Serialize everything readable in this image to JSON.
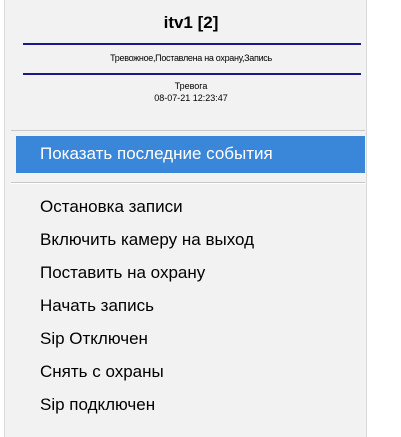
{
  "header": {
    "title": "itv1 [2]",
    "status": "Тревожное,Поставлена на охрану,Запись",
    "event_type": "Тревога",
    "event_time": "08-07-21 12:23:47"
  },
  "highlighted_item": {
    "label": "Показать последние события"
  },
  "menu_items": [
    {
      "label": "Остановка записи"
    },
    {
      "label": "Включить камеру на выход"
    },
    {
      "label": "Поставить на охрану"
    },
    {
      "label": "Начать запись"
    },
    {
      "label": "Sip Отключен"
    },
    {
      "label": "Снять с охраны"
    },
    {
      "label": "Sip подключен"
    }
  ]
}
